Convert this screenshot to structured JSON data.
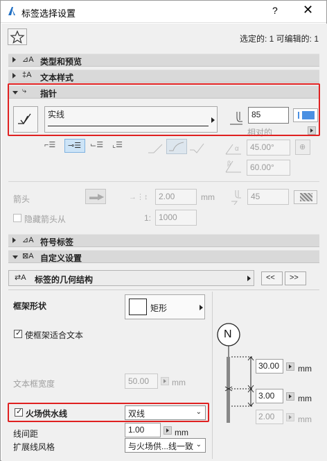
{
  "window": {
    "title": "标签选择设置",
    "help": "?",
    "close": "✕"
  },
  "toolbar": {
    "selection_info": "选定的: 1 可编辑的: 1"
  },
  "sections": {
    "types_preview": "类型和预览",
    "text_style": "文本样式",
    "pointer": "指针",
    "symbol_label": "符号标签",
    "custom_settings": "自定义设置"
  },
  "pointer": {
    "line_type": "实线",
    "pen_value": "85",
    "relative_label": "相对的",
    "angle1": "45.00°",
    "angle2": "60.00°"
  },
  "arrow": {
    "label": "箭头",
    "size": "2.00",
    "size_unit": "mm",
    "pen": "45",
    "hide_label": "隐藏箭头从",
    "scale_prefix": "1:",
    "scale": "1000"
  },
  "custom": {
    "geometry_label": "标签的几何结构",
    "prev": "<<",
    "next": ">>",
    "frame_shape_label": "框架形状",
    "frame_shape_value": "矩形",
    "fit_frame_label": "使框架适合文本",
    "text_width_label": "文本框宽度",
    "text_width_value": "50.00",
    "text_width_unit": "mm",
    "fire_water_label": "火场供水线",
    "fire_water_value": "双线",
    "line_spacing_label": "线间距",
    "line_spacing_value": "1.00",
    "line_spacing_unit": "mm",
    "ext_line_label": "扩展线风格",
    "ext_line_value": "与火场供...线一致",
    "preview_symbol": "N",
    "dim1": "30.00",
    "dim2": "3.00",
    "dim3": "2.00",
    "dim_unit": "mm"
  },
  "colors": {
    "highlight_red": "#e02020",
    "accent_blue": "#4a90e2"
  }
}
